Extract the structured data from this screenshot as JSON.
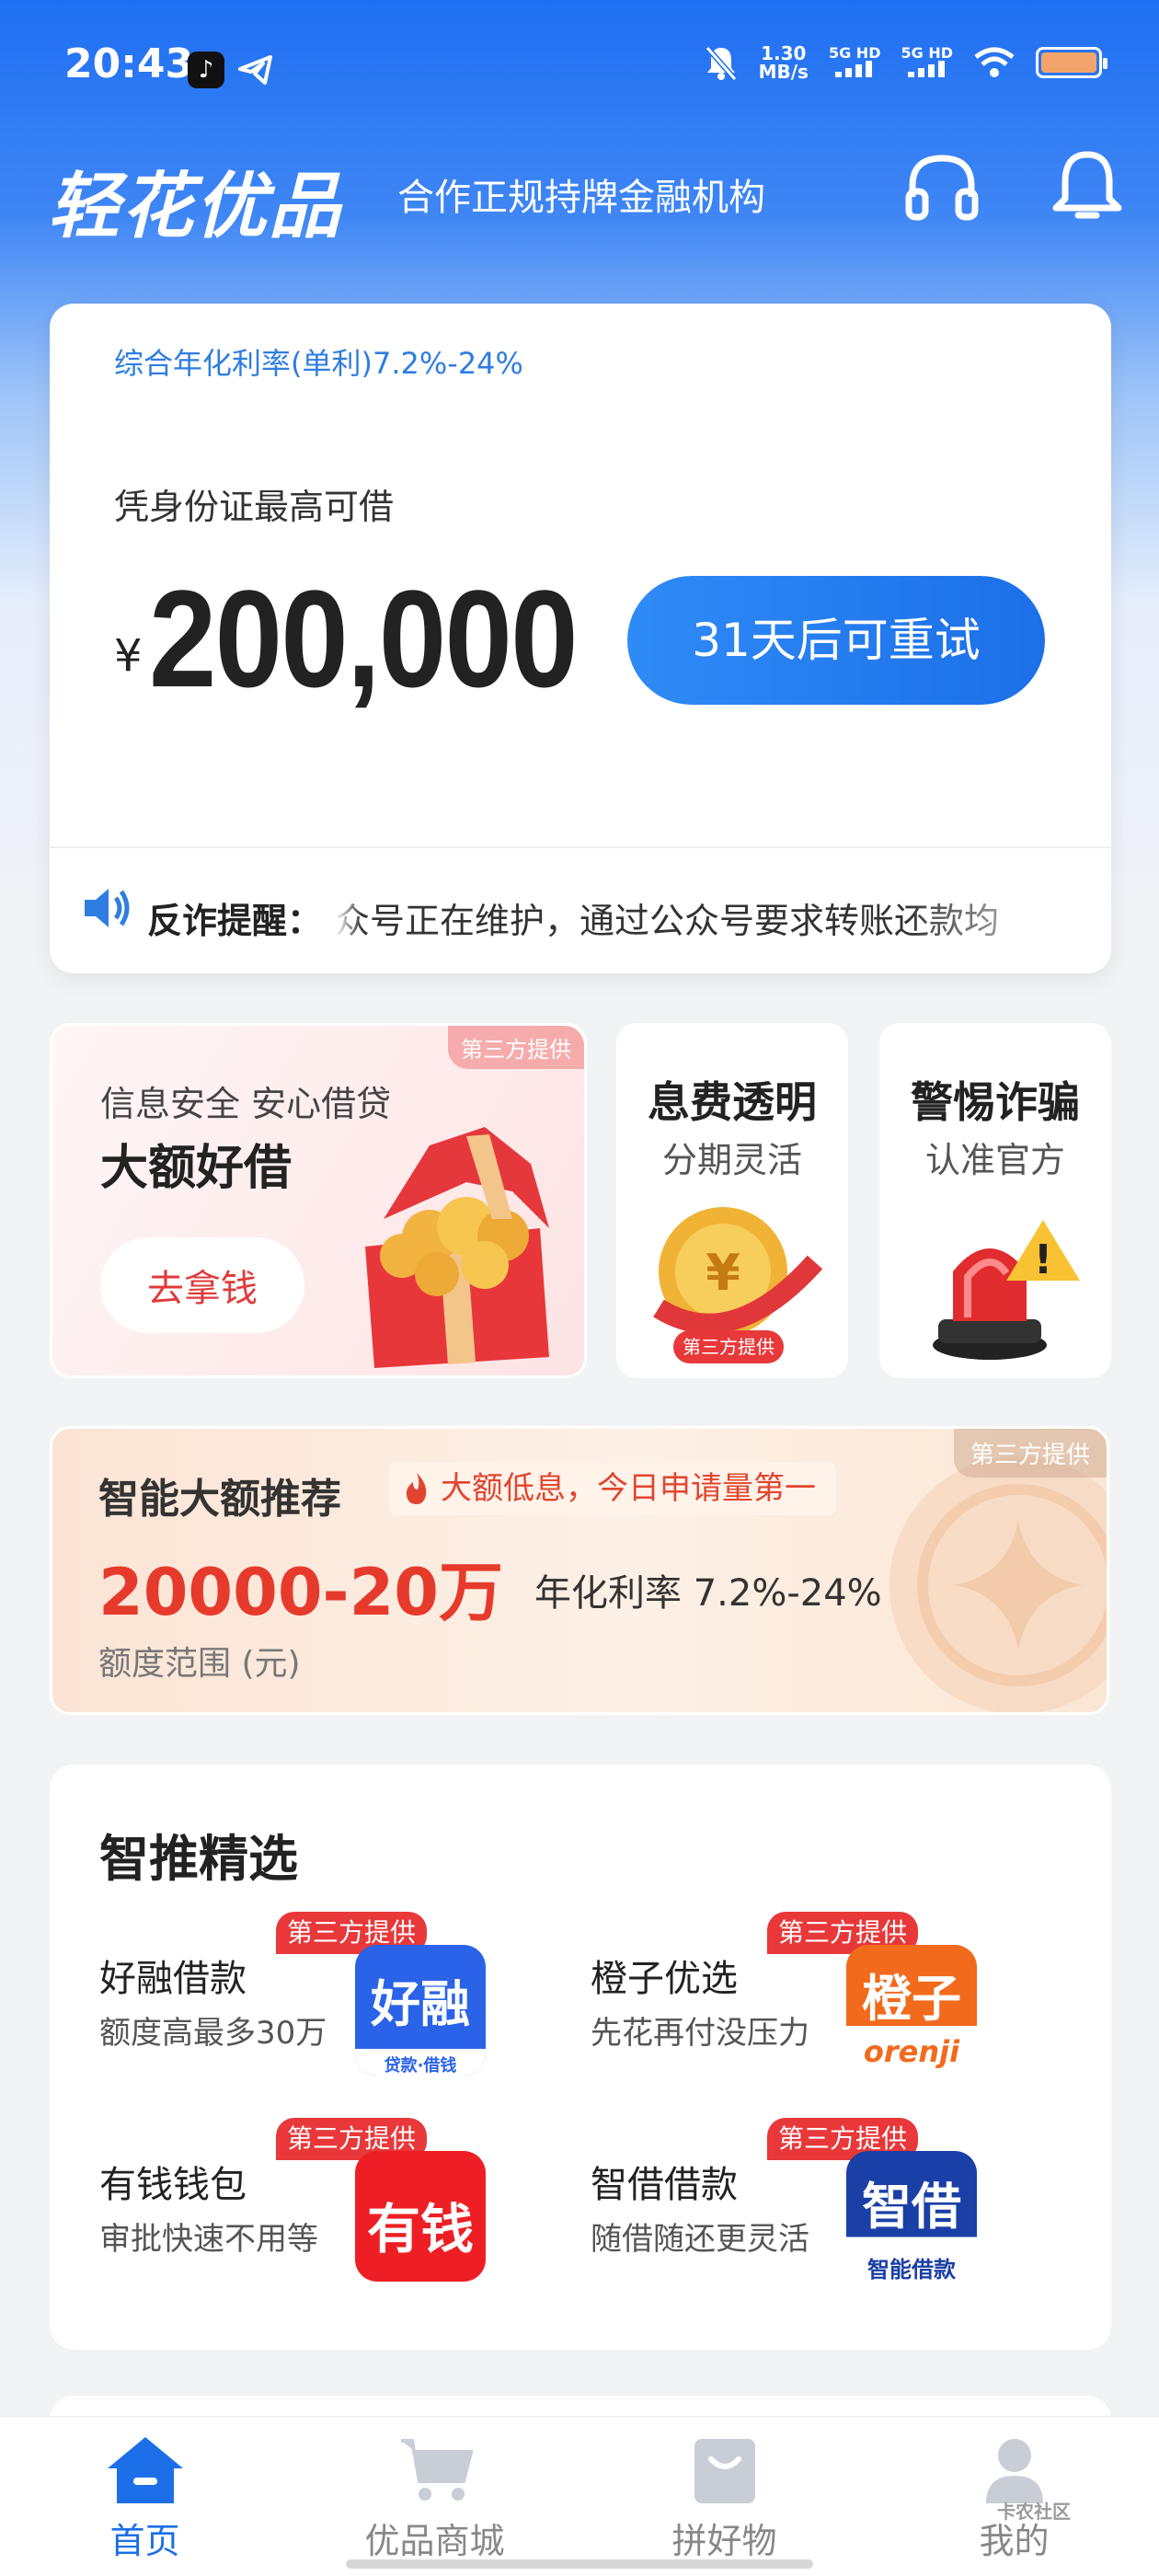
{
  "status_bar": {
    "time": "20:43",
    "net_speed_value": "1.30",
    "net_speed_unit": "MB/s",
    "signal1": "5G HD",
    "signal2": "5G HD"
  },
  "header": {
    "logo_text": "轻花优品",
    "slogan": "合作正规持牌金融机构",
    "support_icon": "headset-icon",
    "notification_icon": "bell-icon"
  },
  "credit_card": {
    "rate_note": "综合年化利率(单利)7.2%-24%",
    "limit_label": "凭身份证最高可借",
    "currency_symbol": "¥",
    "limit_amount": "200,000",
    "retry_button": "31天后可重试",
    "notice_label": "反诈提醒：",
    "notice_text": "众号正在维护，通过公众号要求转账还款均"
  },
  "promo_tiles": {
    "main": {
      "badge": "第三方提供",
      "subtitle": "信息安全 安心借贷",
      "title": "大额好借",
      "button": "去拿钱"
    },
    "fees": {
      "title": "息费透明",
      "subtitle": "分期灵活",
      "badge": "第三方提供"
    },
    "fraud": {
      "title": "警惕诈骗",
      "subtitle": "认准官方"
    }
  },
  "banner": {
    "badge": "第三方提供",
    "title": "智能大额推荐",
    "tag": "大额低息，今日申请量第一",
    "range": "20000-20万",
    "rate": "年化利率 7.2%-24%",
    "range_unit": "额度范围 (元)"
  },
  "picks": {
    "title": "智推精选",
    "items": [
      {
        "badge": "第三方提供",
        "name": "好融借款",
        "desc": "额度高最多30万",
        "logo_text": "好融",
        "logo_sub": "贷款·借钱",
        "color": "#2a63e8"
      },
      {
        "badge": "第三方提供",
        "name": "橙子优选",
        "desc": "先花再付没压力",
        "logo_text": "橙子",
        "logo_sub": "orenji",
        "color": "#f26a1b"
      },
      {
        "badge": "第三方提供",
        "name": "有钱钱包",
        "desc": "审批快速不用等",
        "logo_text": "有钱",
        "logo_sub": "",
        "color": "#ee1f24"
      },
      {
        "badge": "第三方提供",
        "name": "智借借款",
        "desc": "随借随还更灵活",
        "logo_text": "智借",
        "logo_sub": "智能借款",
        "color": "#1a3fa6"
      }
    ]
  },
  "tabbar": {
    "tabs": [
      {
        "label": "首页",
        "icon": "home-icon",
        "active": true
      },
      {
        "label": "优品商城",
        "icon": "cart-icon",
        "active": false
      },
      {
        "label": "拼好物",
        "icon": "bag-icon",
        "active": false
      },
      {
        "label": "我的",
        "icon": "profile-icon",
        "active": false
      }
    ]
  },
  "watermark": "卡农社区"
}
